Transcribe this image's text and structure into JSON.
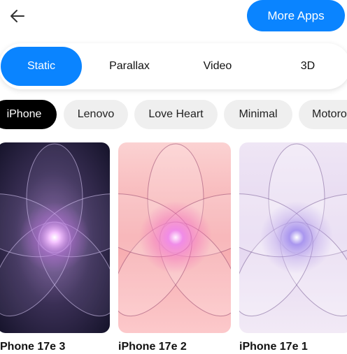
{
  "header": {
    "back_icon": "arrow-left-icon",
    "more_apps_label": "More Apps",
    "accent_color": "#0a84ff"
  },
  "type_tabs": [
    {
      "label": "Static",
      "active": true
    },
    {
      "label": "Parallax",
      "active": false
    },
    {
      "label": "Video",
      "active": false
    },
    {
      "label": "3D",
      "active": false
    }
  ],
  "category_chips": [
    {
      "label": "iPhone",
      "active": true
    },
    {
      "label": "Lenovo",
      "active": false
    },
    {
      "label": "Love Heart",
      "active": false
    },
    {
      "label": "Minimal",
      "active": false
    },
    {
      "label": "Motoro",
      "active": false
    }
  ],
  "wallpapers": [
    {
      "title": "Phone 17e 3",
      "theme": "dark-purple"
    },
    {
      "title": "iPhone 17e 2",
      "theme": "pink"
    },
    {
      "title": "iPhone 17e 1",
      "theme": "lavender"
    }
  ]
}
